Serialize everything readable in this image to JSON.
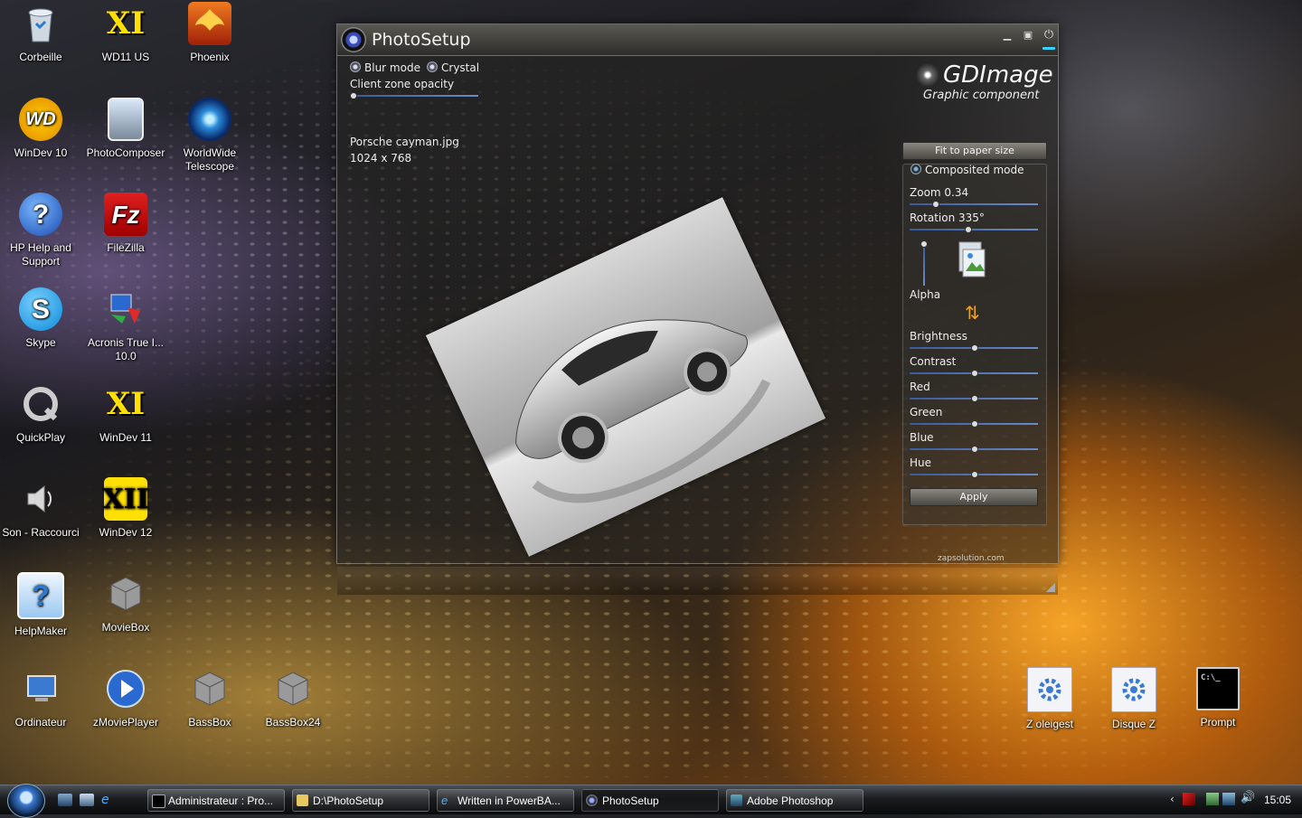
{
  "desktop": {
    "icons": [
      {
        "label": "Corbeille"
      },
      {
        "label": "WD11 US"
      },
      {
        "label": "Phoenix"
      },
      {
        "label": "WinDev 10"
      },
      {
        "label": "PhotoComposer"
      },
      {
        "label": "WorldWide Telescope"
      },
      {
        "label": "HP Help and Support"
      },
      {
        "label": "FileZilla"
      },
      {
        "label": "Skype"
      },
      {
        "label": "Acronis True I... 10.0"
      },
      {
        "label": "QuickPlay"
      },
      {
        "label": "WinDev 11"
      },
      {
        "label": "Son - Raccourci"
      },
      {
        "label": "WinDev 12"
      },
      {
        "label": "HelpMaker"
      },
      {
        "label": "MovieBox"
      },
      {
        "label": "Ordinateur"
      },
      {
        "label": "zMoviePlayer"
      },
      {
        "label": "BassBox"
      },
      {
        "label": "BassBox24"
      },
      {
        "label": "Z oleigest"
      },
      {
        "label": "Disque Z"
      },
      {
        "label": "Prompt"
      }
    ]
  },
  "window": {
    "title": "PhotoSetup",
    "blur_mode": "Blur mode",
    "crystal": "Crystal",
    "opacity_label": "Client zone opacity",
    "file_name": "Porsche cayman.jpg",
    "file_size": "1024 x 768",
    "brand_title": "GDImage",
    "brand_sub": "Graphic component",
    "fit_button": "Fit to paper size",
    "composited_mode": "Composited mode",
    "zoom_label": "Zoom 0.34",
    "rotation_label": "Rotation 335°",
    "alpha_label": "Alpha",
    "sliders": [
      {
        "label": "Brightness",
        "value": 0.5
      },
      {
        "label": "Contrast",
        "value": 0.5
      },
      {
        "label": "Red",
        "value": 0.5
      },
      {
        "label": "Green",
        "value": 0.5
      },
      {
        "label": "Blue",
        "value": 0.5
      },
      {
        "label": "Hue",
        "value": 0.5
      }
    ],
    "zoom_value": 0.2,
    "rotation_value": 0.45,
    "opacity_value": 0.02,
    "alpha_value": 0.0,
    "apply_button": "Apply",
    "footer_link": "zapsolution.com"
  },
  "taskbar": {
    "buttons": [
      {
        "label": "Administrateur : Pro..."
      },
      {
        "label": "D:\\PhotoSetup"
      },
      {
        "label": "Written in PowerBA..."
      },
      {
        "label": "PhotoSetup"
      },
      {
        "label": "Adobe Photoshop"
      }
    ],
    "clock": "15:05"
  }
}
